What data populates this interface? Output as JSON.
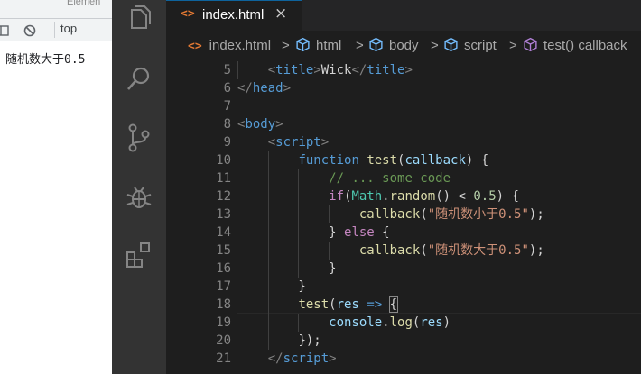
{
  "devtools": {
    "tab_partial": "Elemen",
    "context": "top",
    "console_log": "随机数大于0.5"
  },
  "activity": {
    "icons": [
      "explorer-icon",
      "search-icon",
      "source-control-icon",
      "debug-icon",
      "extensions-icon"
    ]
  },
  "editor": {
    "tab": {
      "label": "index.html",
      "close": "×"
    },
    "breadcrumb": [
      "index.html",
      "html",
      "body",
      "script",
      "test() callback"
    ],
    "breadcrumb_sep": ">",
    "lines": [
      {
        "num": "5",
        "tokens": [
          [
            "t-text",
            "    "
          ],
          [
            "t-punct",
            "<"
          ],
          [
            "t-tag",
            "title"
          ],
          [
            "t-punct",
            ">"
          ],
          [
            "t-text",
            "Wick"
          ],
          [
            "t-punct",
            "</"
          ],
          [
            "t-tag",
            "title"
          ],
          [
            "t-punct",
            ">"
          ]
        ]
      },
      {
        "num": "6",
        "tokens": [
          [
            "t-punct",
            "</"
          ],
          [
            "t-tag",
            "head"
          ],
          [
            "t-punct",
            ">"
          ]
        ]
      },
      {
        "num": "7",
        "tokens": []
      },
      {
        "num": "8",
        "tokens": [
          [
            "t-punct",
            "<"
          ],
          [
            "t-tag",
            "body"
          ],
          [
            "t-punct",
            ">"
          ]
        ]
      },
      {
        "num": "9",
        "tokens": [
          [
            "t-text",
            "    "
          ],
          [
            "t-punct",
            "<"
          ],
          [
            "t-tag",
            "script"
          ],
          [
            "t-punct",
            ">"
          ]
        ]
      },
      {
        "num": "10",
        "tokens": [
          [
            "t-text",
            "        "
          ],
          [
            "t-kw",
            "function"
          ],
          [
            "t-text",
            " "
          ],
          [
            "t-fn",
            "test"
          ],
          [
            "t-text",
            "("
          ],
          [
            "t-param",
            "callback"
          ],
          [
            "t-text",
            ") {"
          ]
        ]
      },
      {
        "num": "11",
        "tokens": [
          [
            "t-text",
            "            "
          ],
          [
            "t-cmt",
            "// ... some code"
          ]
        ]
      },
      {
        "num": "12",
        "tokens": [
          [
            "t-text",
            "            "
          ],
          [
            "t-ctrl",
            "if"
          ],
          [
            "t-text",
            "("
          ],
          [
            "t-class",
            "Math"
          ],
          [
            "t-text",
            "."
          ],
          [
            "t-fn",
            "random"
          ],
          [
            "t-text",
            "() < "
          ],
          [
            "t-num",
            "0.5"
          ],
          [
            "t-text",
            ") {"
          ]
        ]
      },
      {
        "num": "13",
        "tokens": [
          [
            "t-text",
            "                "
          ],
          [
            "t-fn",
            "callback"
          ],
          [
            "t-text",
            "("
          ],
          [
            "t-str",
            "\"随机数小于0.5\""
          ],
          [
            "t-text",
            ");"
          ]
        ]
      },
      {
        "num": "14",
        "tokens": [
          [
            "t-text",
            "            "
          ],
          [
            "t-text",
            "} "
          ],
          [
            "t-ctrl",
            "else"
          ],
          [
            "t-text",
            " {"
          ]
        ]
      },
      {
        "num": "15",
        "tokens": [
          [
            "t-text",
            "                "
          ],
          [
            "t-fn",
            "callback"
          ],
          [
            "t-text",
            "("
          ],
          [
            "t-str",
            "\"随机数大于0.5\""
          ],
          [
            "t-text",
            ");"
          ]
        ]
      },
      {
        "num": "16",
        "tokens": [
          [
            "t-text",
            "            }"
          ]
        ]
      },
      {
        "num": "17",
        "tokens": [
          [
            "t-text",
            "        }"
          ]
        ]
      },
      {
        "num": "18",
        "tokens": [
          [
            "t-text",
            "        "
          ],
          [
            "t-fn",
            "test"
          ],
          [
            "t-text",
            "("
          ],
          [
            "t-param",
            "res"
          ],
          [
            "t-text",
            " "
          ],
          [
            "t-kw",
            "=>"
          ],
          [
            "t-text",
            " "
          ],
          [
            "t-bracket",
            "{"
          ]
        ]
      },
      {
        "num": "19",
        "tokens": [
          [
            "t-text",
            "            "
          ],
          [
            "t-param",
            "console"
          ],
          [
            "t-text",
            "."
          ],
          [
            "t-fn",
            "log"
          ],
          [
            "t-text",
            "("
          ],
          [
            "t-param",
            "res"
          ],
          [
            "t-text",
            ")"
          ]
        ]
      },
      {
        "num": "20",
        "tokens": [
          [
            "t-text",
            "        "
          ],
          [
            "t-text",
            "});"
          ]
        ]
      },
      {
        "num": "21",
        "tokens": [
          [
            "t-text",
            "    "
          ],
          [
            "t-punct",
            "</"
          ],
          [
            "t-tag",
            "script"
          ],
          [
            "t-punct",
            ">"
          ]
        ]
      }
    ]
  }
}
